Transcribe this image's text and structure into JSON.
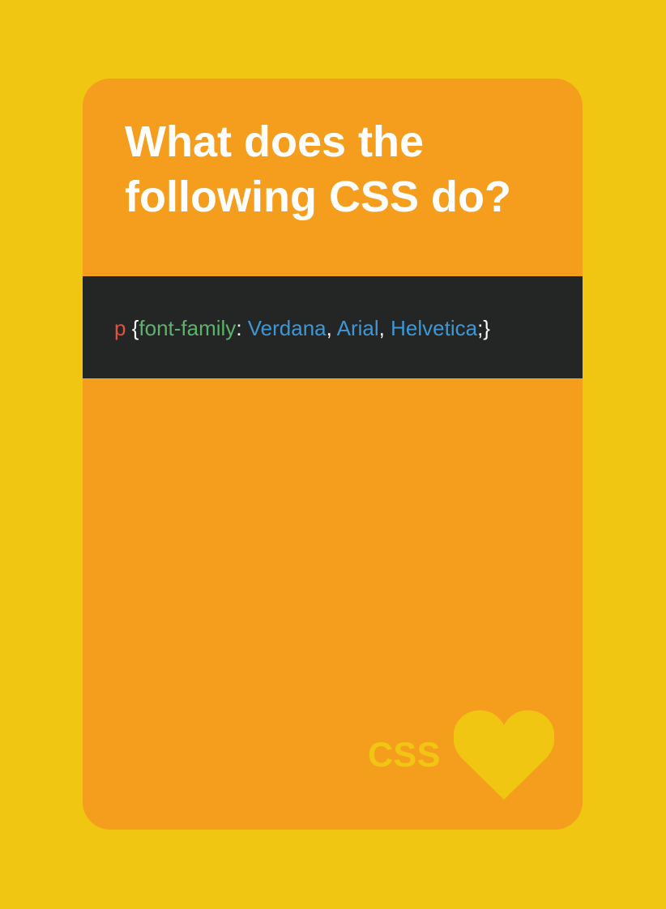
{
  "card": {
    "title": "What does the following CSS do?",
    "code": {
      "selector": "p",
      "open_brace": " {",
      "property": "font-family",
      "colon": ": ",
      "values": [
        "Verdana",
        "Arial",
        "Helvetica"
      ],
      "separator": ", ",
      "end": ";}"
    },
    "brand": "CSS",
    "brand_icon": "heart-icon"
  },
  "colors": {
    "page_background": "#F0C612",
    "card_background": "#F59E1E",
    "code_background": "#242525",
    "selector": "#E2533E",
    "property": "#5DB36C",
    "value": "#3E97D5",
    "brand": "#F0C612"
  }
}
